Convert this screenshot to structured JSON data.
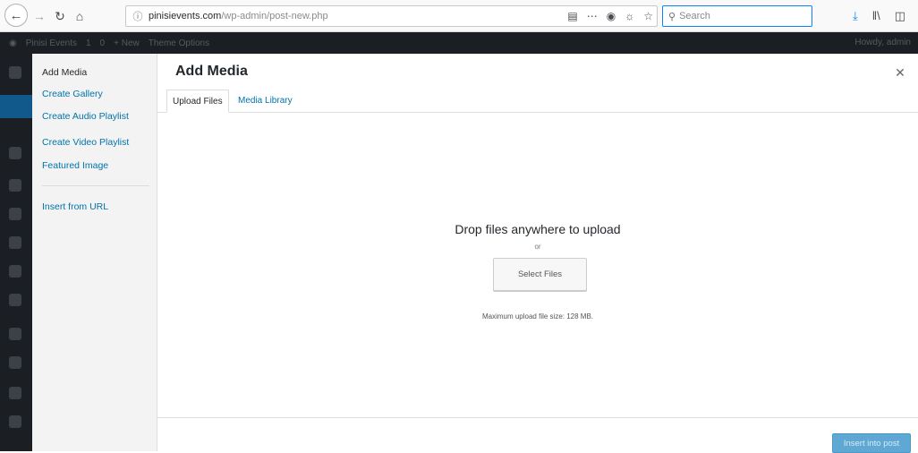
{
  "browser": {
    "url_domain": "pinisievents.com",
    "url_path": "/wp-admin/post-new.php",
    "search_placeholder": "Search"
  },
  "admin_bar": {
    "site_name": "Pinisi Events",
    "updates_count": "1",
    "comments_count": "0",
    "new_label": "+ New",
    "theme_options": "Theme Options",
    "howdy": "Howdy, admin"
  },
  "modal": {
    "title": "Add Media",
    "sidebar": {
      "items": [
        {
          "label": "Add Media"
        },
        {
          "label": "Create Gallery"
        },
        {
          "label": "Create Audio Playlist"
        },
        {
          "label": "Create Video Playlist"
        },
        {
          "label": "Featured Image"
        },
        {
          "label": "Insert from URL"
        }
      ]
    },
    "tabs": [
      {
        "label": "Upload Files"
      },
      {
        "label": "Media Library"
      }
    ],
    "upload": {
      "instructions": "Drop files anywhere to upload",
      "or": "or",
      "button": "Select Files",
      "max_size": "Maximum upload file size: 128 MB."
    },
    "footer": {
      "insert_button": "Insert into post"
    }
  }
}
